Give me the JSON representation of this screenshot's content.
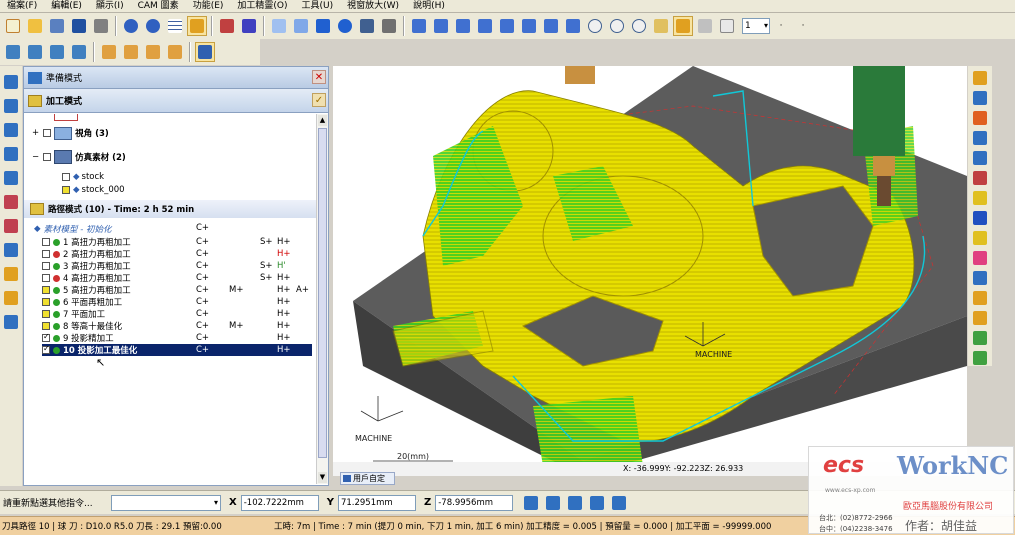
{
  "menu": [
    "檔案(F)",
    "編輯(E)",
    "顯示(I)",
    "CAM 圖素",
    "功能(E)",
    "加工精靈(O)",
    "工具(U)",
    "視窗放大(W)",
    "說明(H)"
  ],
  "toolbar": {
    "combo_value": "1"
  },
  "panel": {
    "title": "準備模式",
    "mode": "加工模式",
    "view_label": "視角 (3)",
    "stock_label": "仿真素材 (2)",
    "stock_items": [
      "stock",
      "stock_000"
    ],
    "path_header": "路徑模式 (10) - Time: 2 h 52 min",
    "material_label": "素材模型 - 初始化",
    "material_c": "C+",
    "operations": [
      {
        "label": "1 高扭力再粗加工",
        "c": "C+",
        "m": "",
        "s": "S+",
        "h": "H+",
        "a": "",
        "checked": false,
        "dot": "#2aa02a",
        "h_color": "#000"
      },
      {
        "label": "2 高扭力再粗加工",
        "c": "C+",
        "m": "",
        "s": "",
        "h": "H+",
        "a": "",
        "checked": false,
        "dot": "#d03030",
        "h_color": "#d00000"
      },
      {
        "label": "3 高扭力再粗加工",
        "c": "C+",
        "m": "",
        "s": "S+",
        "h": "H'",
        "a": "",
        "checked": false,
        "dot": "#2aa02a",
        "h_color": "#2a8a2a"
      },
      {
        "label": "4 高扭力再粗加工",
        "c": "C+",
        "m": "",
        "s": "S+",
        "h": "H+",
        "a": "",
        "checked": false,
        "dot": "#d03030",
        "h_color": "#000"
      },
      {
        "label": "5 高扭力再粗加工",
        "c": "C+",
        "m": "M+",
        "s": "",
        "h": "H+",
        "a": "A+",
        "checked": false,
        "dot": "#2aa02a",
        "h_color": "#000"
      },
      {
        "label": "6 平面再粗加工",
        "c": "C+",
        "m": "",
        "s": "",
        "h": "H+",
        "a": "",
        "checked": false,
        "dot": "#2aa02a",
        "h_color": "#000"
      },
      {
        "label": "7 平面加工",
        "c": "C+",
        "m": "",
        "s": "",
        "h": "H+",
        "a": "",
        "checked": false,
        "dot": "#2aa02a",
        "h_color": "#000"
      },
      {
        "label": "8 等高十最佳化",
        "c": "C+",
        "m": "M+",
        "s": "",
        "h": "H+",
        "a": "",
        "checked": false,
        "dot": "#2aa02a",
        "h_color": "#000"
      },
      {
        "label": "9 投影精加工",
        "c": "C+",
        "m": "",
        "s": "",
        "h": "H+",
        "a": "",
        "checked": true,
        "dot": "#2aa02a",
        "h_color": "#000"
      },
      {
        "label": "10 投影加工最佳化",
        "c": "C+",
        "m": "",
        "s": "",
        "h": "H+",
        "a": "",
        "checked": true,
        "dot": "#2aa02a",
        "h_color": "#fff"
      }
    ]
  },
  "viewport": {
    "machine_label_1": "MACHINE",
    "machine_label_2": "MACHINE",
    "scale_label": "20(mm)",
    "coords": "X: -36.999Y: -92.223Z: 26.933",
    "user_defined": "用戶自定"
  },
  "inputbar": {
    "prompt": "請重新點選其他指令...",
    "x_label": "X",
    "x_value": "-102.7222mm",
    "y_label": "Y",
    "y_value": "71.2951mm",
    "z_label": "Z",
    "z_value": "-78.9956mm"
  },
  "statusbar": {
    "left": "刀具路徑 10 | 球  刀 : D10.0 R5.0   刀長 : 29.1 預留:0.00",
    "right": "工時:   7m | Time : 7 min (提刀 0 min, 下刀 1 min, 加工 6 min) 加工精度 = 0.005 | 預留量 = 0.000 | 加工平面 = -99999.000"
  },
  "logo": {
    "brand1": "ecs",
    "brand2": "WorkNC",
    "website": "www.ecs-xp.com",
    "company": "歐亞馬腦股份有限公司",
    "tel1": "台北：(02)8772-2966",
    "tel2": "台中：(04)2238-3476",
    "author": "作者：胡佳益"
  },
  "colors": {
    "toolpath_yellow": "#e8e000",
    "toolpath_green": "#30d020",
    "cyan_path": "#10c8d8",
    "stock_gray": "#606060",
    "tool_green": "#2a7a3a",
    "selection_blue": "#0a246a"
  }
}
